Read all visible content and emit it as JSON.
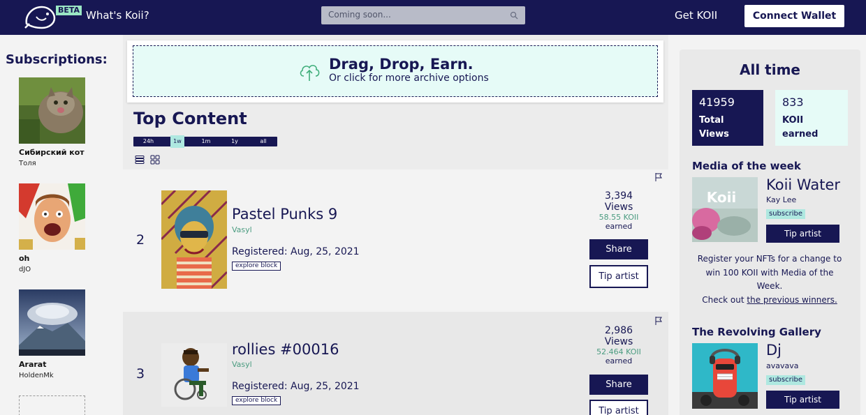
{
  "header": {
    "beta": "BETA",
    "whats_koii": "What's Koii?",
    "search_placeholder": "Coming soon...",
    "get_koii": "Get KOII",
    "connect_wallet": "Connect Wallet"
  },
  "sidebar": {
    "title": "Subscriptions:",
    "items": [
      {
        "name": "Сибирский кот",
        "user": "Толя"
      },
      {
        "name": "oh",
        "user": "dJO"
      },
      {
        "name": "Ararat",
        "user": "HoldenMk"
      }
    ]
  },
  "upload": {
    "title": "Drag, Drop, Earn.",
    "subtitle": "Or click for more archive options"
  },
  "top_content": {
    "title": "Top Content",
    "periods": [
      "24h",
      "1w",
      "1m",
      "1y",
      "all"
    ],
    "active_period": "1w"
  },
  "rows": [
    {
      "rank": "2",
      "title": "Pastel Punks 9",
      "artist": "Vasyl",
      "registered": "Registered: Aug, 25, 2021",
      "explore": "explore block",
      "views": "3,394",
      "views_label": "Views",
      "earned": "58.55 KOII",
      "earned_label": "earned",
      "share": "Share",
      "tip": "Tip artist"
    },
    {
      "rank": "3",
      "title": "rollies #00016",
      "artist": "Vasyl",
      "registered": "Registered: Aug, 25, 2021",
      "explore": "explore block",
      "views": "2,986",
      "views_label": "Views",
      "earned": "52.464 KOII",
      "earned_label": "earned",
      "share": "Share",
      "tip": "Tip artist"
    }
  ],
  "right": {
    "all_time": "All time",
    "total_views_num": "41959",
    "total_views_label": "Total Views",
    "koii_earned_num": "833",
    "koii_earned_label_1": "KOII",
    "koii_earned_label_2": "earned",
    "media_week_title": "Media of the week",
    "media_week_art": "Koii Water",
    "media_week_artist": "Kay Lee",
    "subscribe": "subscribe",
    "tip_artist": "Tip artist",
    "register_text": "Register your NFTs for a change to win 100 KOII with Media of the Week.",
    "checkout_text": "Check out",
    "checkout_link": "the previous winners.",
    "gallery_title": "The Revolving Gallery",
    "gallery_art": "Dj",
    "gallery_artist": "avavava"
  },
  "colors": {
    "navy": "#171753",
    "mint": "#e6fbf7",
    "teal": "#aee8e0",
    "green_text": "#4b9c80"
  }
}
